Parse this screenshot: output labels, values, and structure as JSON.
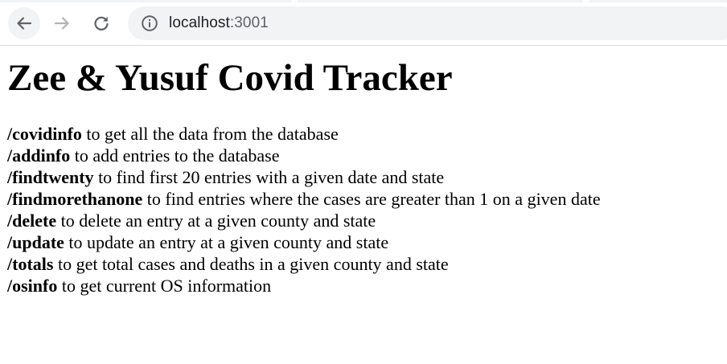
{
  "browser": {
    "url_host": "localhost",
    "url_port": ":3001",
    "icons": {
      "back": "back-arrow-icon",
      "forward": "forward-arrow-icon",
      "reload": "reload-icon",
      "info": "info-icon"
    }
  },
  "page": {
    "title": "Zee & Yusuf Covid Tracker",
    "routes": [
      {
        "path": "/covidinfo",
        "description": " to get all the data from the database"
      },
      {
        "path": "/addinfo",
        "description": " to add entries to the database"
      },
      {
        "path": "/findtwenty",
        "description": " to find first 20 entries with a given date and state"
      },
      {
        "path": "/findmorethanone",
        "description": " to find entries where the cases are greater than 1 on a given date"
      },
      {
        "path": "/delete",
        "description": " to delete an entry at a given county and state"
      },
      {
        "path": "/update",
        "description": " to update an entry at a given county and state"
      },
      {
        "path": "/totals",
        "description": " to get total cases and deaths in a given county and state"
      },
      {
        "path": "/osinfo",
        "description": " to get current OS information"
      }
    ]
  }
}
